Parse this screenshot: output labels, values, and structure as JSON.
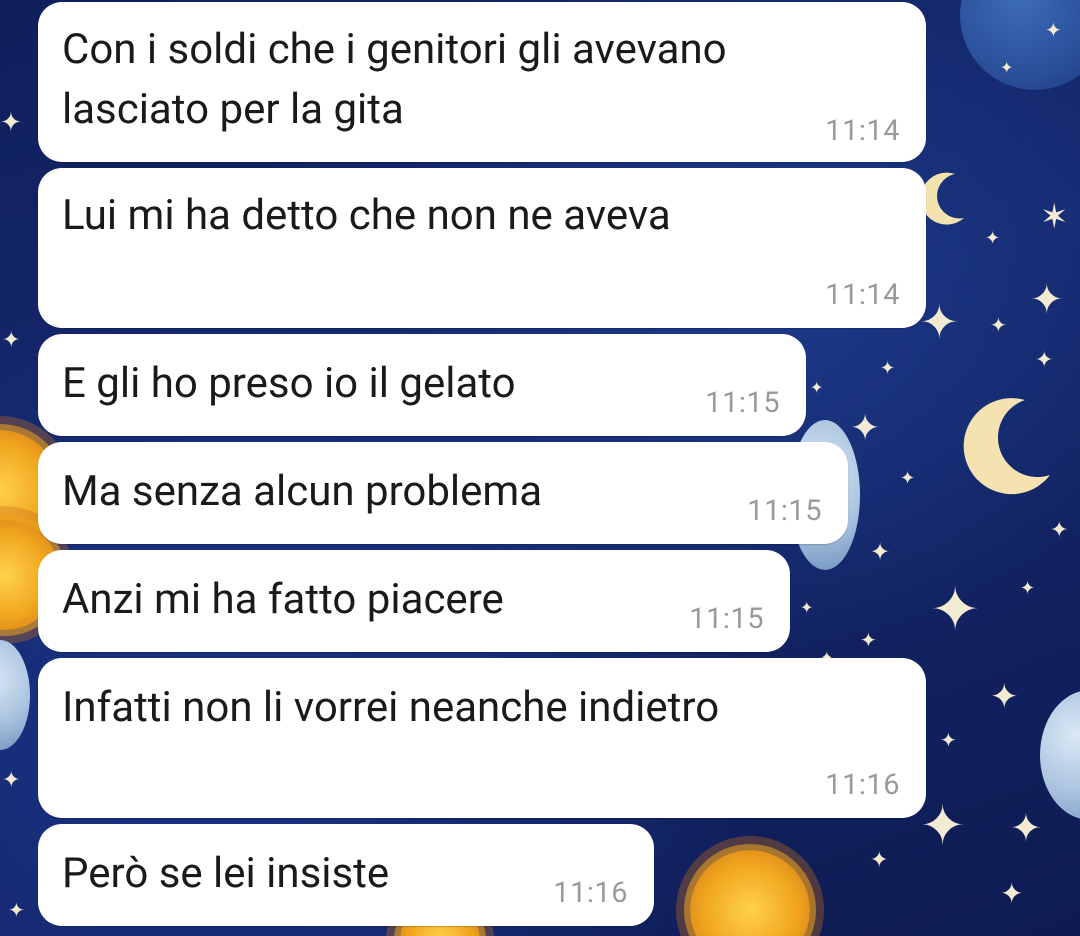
{
  "chat": {
    "messages": [
      {
        "text_line1": "Con i soldi che i genitori gli avevano",
        "text_line2": "lasciato per la gita",
        "time": "11:14"
      },
      {
        "text": "Lui mi ha detto che non ne aveva",
        "time": "11:14"
      },
      {
        "text": "E gli ho preso io il gelato",
        "time": "11:15"
      },
      {
        "text": "Ma senza alcun problema",
        "time": "11:15"
      },
      {
        "text": "Anzi mi ha fatto piacere",
        "time": "11:15"
      },
      {
        "text": "Infatti non li vorrei neanche indietro",
        "time": "11:16"
      },
      {
        "text": "Però se lei insiste",
        "time": "11:16"
      }
    ]
  },
  "wallpaper": {
    "theme": "celestial-sun-moon-stars",
    "colors": {
      "background": "#15296e",
      "sun": "#f0a51e",
      "moon": "#f4e3b0",
      "star": "#f3ead2"
    }
  },
  "icons": {
    "star": "star-icon",
    "moon": "crescent-moon-icon",
    "sun": "sun-icon"
  }
}
